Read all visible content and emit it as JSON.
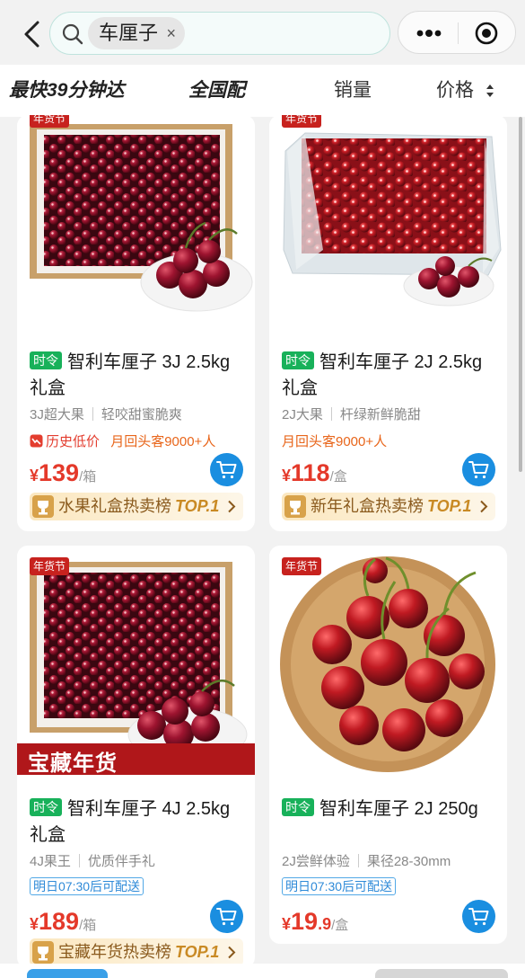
{
  "search": {
    "query": "车厘子",
    "clear_icon": "×"
  },
  "filters": [
    {
      "label": "最快39分钟达",
      "style": "brand"
    },
    {
      "label": "全国配",
      "style": "brand"
    },
    {
      "label": "销量",
      "style": "plain"
    },
    {
      "label": "价格",
      "style": "plain"
    }
  ],
  "products": [
    {
      "tag": "年货节",
      "badge": "时令",
      "title": "智利车厘子 3J 2.5kg 礼盒",
      "spec1": "3J超大果",
      "spec2": "轻咬甜蜜脆爽",
      "history_label": "历史低价",
      "repeat_label": "月回头客9000+人",
      "price_int": "139",
      "price_dec": "",
      "unit": "/箱",
      "rank_label": "水果礼盒热卖榜",
      "rank_top": "TOP.1"
    },
    {
      "tag": "年货节",
      "badge": "时令",
      "title": "智利车厘子 2J 2.5kg 礼盒",
      "spec1": "2J大果",
      "spec2": "杆绿新鲜脆甜",
      "repeat_label": "月回头客9000+人",
      "price_int": "118",
      "price_dec": "",
      "unit": "/盒",
      "rank_label": "新年礼盒热卖榜",
      "rank_top": "TOP.1"
    },
    {
      "tag": "年货节",
      "banner": "宝藏年货",
      "badge": "时令",
      "title": "智利车厘子 4J 2.5kg 礼盒",
      "spec1": "4J果王",
      "spec2": "优质伴手礼",
      "delivery": "明日07:30后可配送",
      "price_int": "189",
      "price_dec": "",
      "unit": "/箱",
      "rank_label": "宝藏年货热卖榜",
      "rank_top": "TOP.1"
    },
    {
      "tag": "年货节",
      "badge": "时令",
      "title": "智利车厘子 2J 250g",
      "spec1": "2J尝鲜体验",
      "spec2": "果径28-30mm",
      "delivery": "明日07:30后可配送",
      "price_int": "19",
      "price_dec": ".9",
      "unit": "/盒"
    }
  ],
  "currency": "¥",
  "colors": {
    "price": "#e4392a",
    "season_badge": "#18b15a",
    "cart": "#1a8ee0",
    "tag": "#c7221e"
  }
}
